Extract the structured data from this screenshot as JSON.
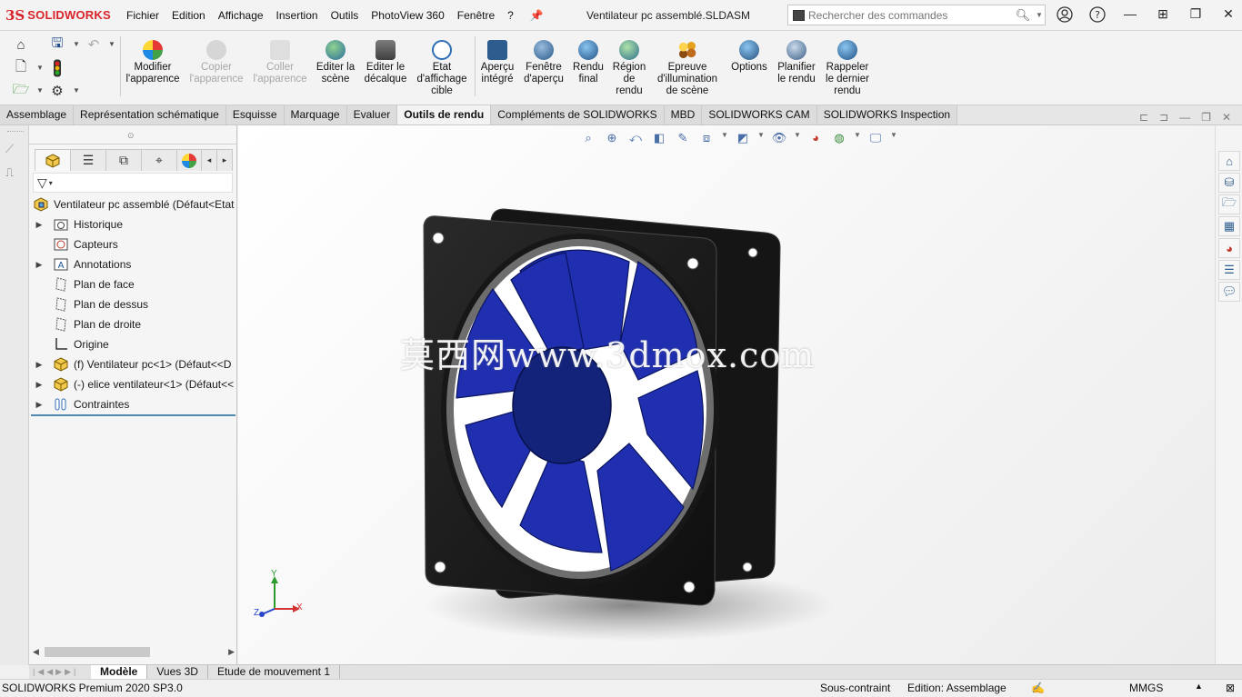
{
  "app": {
    "logo_mark": "3S",
    "brand": "SOLIDWORKS",
    "document_title": "Ventilateur pc assemblé.SLDASM"
  },
  "menu": [
    "Fichier",
    "Edition",
    "Affichage",
    "Insertion",
    "Outils",
    "PhotoView 360",
    "Fenêtre",
    "?"
  ],
  "search": {
    "placeholder": "Rechercher des commandes"
  },
  "toolbar": {
    "modifier_apparence": "Modifier l'apparence",
    "copier_apparence": "Copier l'apparence",
    "coller_apparence": "Coller l'apparence",
    "editer_scene": "Editer la scène",
    "editer_decalque": "Editer le décalque",
    "etat_affichage": "Etat d'affichage cible",
    "apercu_integre": "Aperçu intégré",
    "fenetre_apercu": "Fenêtre d'aperçu",
    "rendu_final": "Rendu final",
    "region_rendu": "Région de rendu",
    "epreuve_illumination": "Epreuve d'illumination de scène",
    "options": "Options",
    "planifier_rendu": "Planifier le rendu",
    "rappeler_rendu": "Rappeler le dernier rendu"
  },
  "tabs": [
    "Assemblage",
    "Représentation schématique",
    "Esquisse",
    "Marquage",
    "Evaluer",
    "Outils de rendu",
    "Compléments de SOLIDWORKS",
    "MBD",
    "SOLIDWORKS CAM",
    "SOLIDWORKS Inspection"
  ],
  "active_tab": "Outils de rendu",
  "tree": {
    "root": "Ventilateur pc assemblé  (Défaut<Etat",
    "items": [
      {
        "label": "Historique",
        "icon": "history-folder-icon",
        "expandable": true
      },
      {
        "label": "Capteurs",
        "icon": "sensor-icon",
        "expandable": false
      },
      {
        "label": "Annotations",
        "icon": "annotation-icon",
        "expandable": true
      },
      {
        "label": "Plan de face",
        "icon": "plane-icon",
        "expandable": false
      },
      {
        "label": "Plan de dessus",
        "icon": "plane-icon",
        "expandable": false
      },
      {
        "label": "Plan de droite",
        "icon": "plane-icon",
        "expandable": false
      },
      {
        "label": "Origine",
        "icon": "origin-icon",
        "expandable": false
      },
      {
        "label": "(f) Ventilateur pc<1> (Défaut<<D",
        "icon": "part-icon",
        "expandable": true
      },
      {
        "label": "(-) elice ventilateur<1> (Défaut<<",
        "icon": "part-icon",
        "expandable": true
      },
      {
        "label": "Contraintes",
        "icon": "mates-icon",
        "expandable": true
      }
    ]
  },
  "viewport": {
    "watermark": "莫西网www.3dmox.com",
    "triad": {
      "x": "X",
      "y": "Y",
      "z": "Z"
    }
  },
  "bottom_tabs": [
    "Modèle",
    "Vues 3D",
    "Etude de mouvement 1"
  ],
  "active_bottom_tab": "Modèle",
  "status": {
    "product": "SOLIDWORKS Premium 2020 SP3.0",
    "constraint": "Sous-contraint",
    "mode": "Edition: Assemblage",
    "units": "MMGS"
  },
  "colors": {
    "brand_red": "#d8232a",
    "fan_frame": "#161616",
    "fan_blade": "#1f2fb0"
  }
}
